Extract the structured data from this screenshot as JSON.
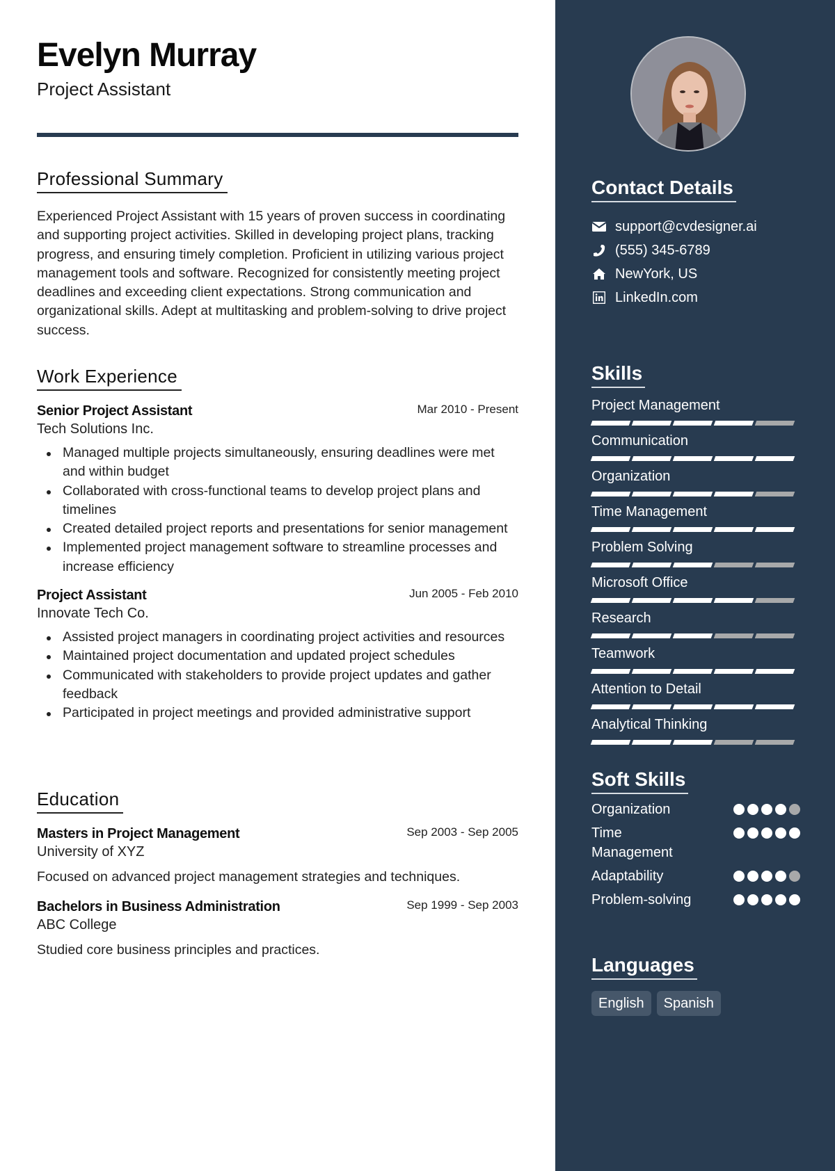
{
  "header": {
    "name": "Evelyn Murray",
    "title": "Project Assistant"
  },
  "colors": {
    "sidebar": "#283b50",
    "accent_rule": "#283b50",
    "skill_filled": "#ffffff",
    "skill_empty": "#a8a9aa",
    "chip": "#46576a"
  },
  "summary": {
    "heading": "Professional Summary",
    "text": "Experienced Project Assistant with 15 years of proven success in coordinating and supporting project activities. Skilled in developing project plans, tracking progress, and ensuring timely completion. Proficient in utilizing various project management tools and software. Recognized for consistently meeting project deadlines and exceeding client expectations. Strong communication and organizational skills. Adept at multitasking and problem-solving to drive project success."
  },
  "work": {
    "heading": "Work Experience",
    "entries": [
      {
        "title": "Senior Project Assistant",
        "date": "Mar 2010 - Present",
        "org": "Tech Solutions Inc.",
        "bullets": [
          "Managed multiple projects simultaneously, ensuring deadlines were met and within budget",
          "Collaborated with cross-functional teams to develop project plans and timelines",
          "Created detailed project reports and presentations for senior management",
          "Implemented project management software to streamline processes and increase efficiency"
        ]
      },
      {
        "title": "Project Assistant",
        "date": "Jun 2005 - Feb 2010",
        "org": "Innovate Tech Co.",
        "bullets": [
          "Assisted project managers in coordinating project activities and resources",
          "Maintained project documentation and updated project schedules",
          "Communicated with stakeholders to provide project updates and gather feedback",
          "Participated in project meetings and provided administrative support"
        ]
      }
    ]
  },
  "education": {
    "heading": "Education",
    "entries": [
      {
        "title": "Masters in Project Management",
        "date": "Sep 2003 - Sep 2005",
        "org": "University of XYZ",
        "desc": "Focused on advanced project management strategies and techniques."
      },
      {
        "title": "Bachelors in Business Administration",
        "date": "Sep 1999 - Sep 2003",
        "org": "ABC College",
        "desc": "Studied core business principles and practices."
      }
    ]
  },
  "contact": {
    "heading": "Contact Details",
    "items": [
      {
        "icon": "envelope-icon",
        "text": "support@cvdesigner.ai"
      },
      {
        "icon": "phone-icon",
        "text": "(555) 345-6789"
      },
      {
        "icon": "home-icon",
        "text": "NewYork, US"
      },
      {
        "icon": "linkedin-icon",
        "text": "LinkedIn.com"
      }
    ]
  },
  "skills": {
    "heading": "Skills",
    "max": 5,
    "items": [
      {
        "name": "Project Management",
        "level": 4
      },
      {
        "name": "Communication",
        "level": 5
      },
      {
        "name": "Organization",
        "level": 4
      },
      {
        "name": "Time Management",
        "level": 5
      },
      {
        "name": "Problem Solving",
        "level": 3
      },
      {
        "name": "Microsoft Office",
        "level": 4
      },
      {
        "name": "Research",
        "level": 3
      },
      {
        "name": "Teamwork",
        "level": 5
      },
      {
        "name": "Attention to Detail",
        "level": 5
      },
      {
        "name": "Analytical Thinking",
        "level": 3
      }
    ]
  },
  "soft_skills": {
    "heading": "Soft Skills",
    "max": 5,
    "items": [
      {
        "name": "Organization",
        "level": 4
      },
      {
        "name": "Time Management",
        "level": 5
      },
      {
        "name": "Adaptability",
        "level": 4
      },
      {
        "name": "Problem-solving",
        "level": 5
      }
    ]
  },
  "languages": {
    "heading": "Languages",
    "items": [
      "English",
      "Spanish"
    ]
  }
}
